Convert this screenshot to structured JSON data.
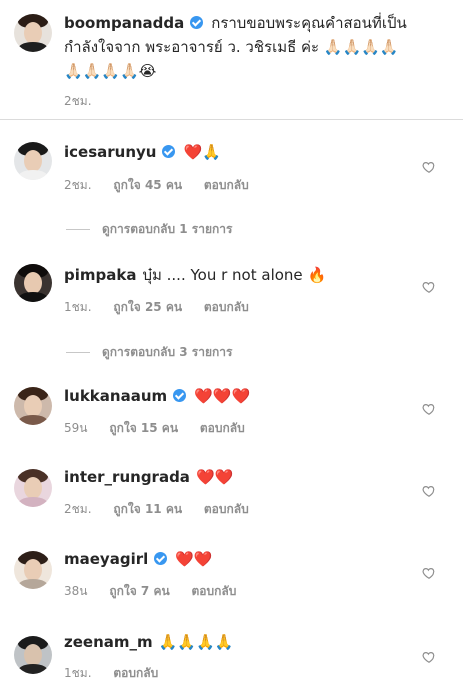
{
  "caption": {
    "username": "boompanadda",
    "line1": "กราบขอบพระคุณคำสอนที่เป็น",
    "line2": "กำลังใจจาก พระอาจารย์ ว. วชิรเมธี ค่ะ",
    "line2_emoji": "🙏🏻🙏🏻🙏🏻🙏🏻",
    "line3_emoji": "🙏🏻🙏🏻🙏🏻🙏🏻😭",
    "time": "2ชม."
  },
  "labels": {
    "reply": "ตอบกลับ"
  },
  "comments": [
    {
      "username": "icesarunyu",
      "verified": true,
      "text": "",
      "emoji": "❤️🙏",
      "time": "2ชม.",
      "likes": "ถูกใจ 45 คน",
      "view_replies": "ดูการตอบกลับ 1 รายการ"
    },
    {
      "username": "pimpaka",
      "verified": false,
      "text": "บุ๋ม .... You r not alone",
      "emoji": "🔥",
      "time": "1ชม.",
      "likes": "ถูกใจ 25 คน",
      "view_replies": "ดูการตอบกลับ 3 รายการ"
    },
    {
      "username": "lukkanaaum",
      "verified": true,
      "text": "",
      "emoji": "❤️❤️❤️",
      "time": "59น",
      "likes": "ถูกใจ 15 คน",
      "view_replies": ""
    },
    {
      "username": "inter_rungrada",
      "verified": false,
      "text": "",
      "emoji": "❤️❤️",
      "time": "2ชม.",
      "likes": "ถูกใจ 11 คน",
      "view_replies": ""
    },
    {
      "username": "maeyagirl",
      "verified": true,
      "text": "",
      "emoji": "❤️❤️",
      "time": "38น",
      "likes": "ถูกใจ 7 คน",
      "view_replies": ""
    },
    {
      "username": "zeenam_m",
      "verified": false,
      "text": "",
      "emoji": "🙏🙏🙏🙏",
      "time": "1ชม.",
      "likes": "",
      "view_replies": ""
    }
  ],
  "colors": {
    "verified": "#3897f0",
    "heart_emoji": "#e0245e",
    "muted_text": "#8e8e8e"
  }
}
